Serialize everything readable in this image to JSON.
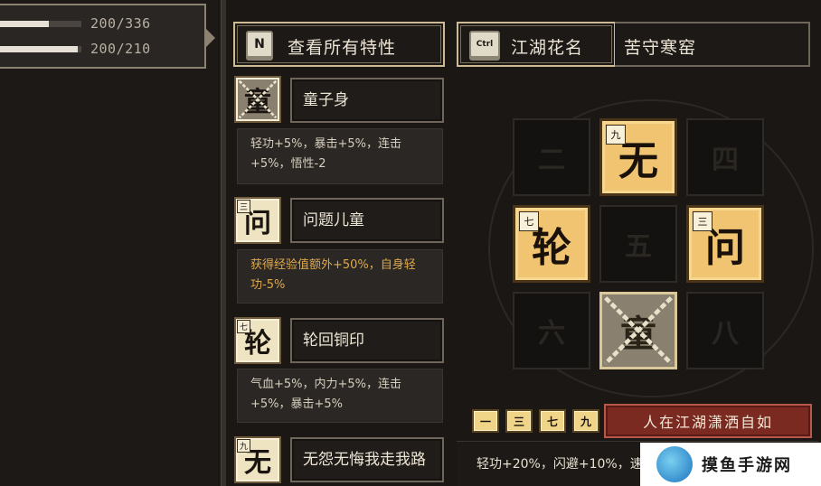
{
  "status": {
    "stats": [
      {
        "text": "200/336",
        "fill": 0.595
      },
      {
        "text": "200/210",
        "fill": 0.952
      }
    ]
  },
  "view_all_traits": {
    "key": "N",
    "label": "查看所有特性"
  },
  "traits": [
    {
      "glyph": "童",
      "num": "",
      "name": "童子身",
      "desc": "轻功+5%，暴击+5%，连击+5%，悟性-2",
      "highlight": false,
      "locked": true
    },
    {
      "glyph": "问",
      "num": "三",
      "name": "问题儿童",
      "desc": "获得经验值额外+50%，自身轻功-5%",
      "highlight": true,
      "locked": false
    },
    {
      "glyph": "轮",
      "num": "七",
      "name": "轮回铜印",
      "desc": "气血+5%，内力+5%，连击+5%，暴击+5%",
      "highlight": false,
      "locked": false
    },
    {
      "glyph": "无",
      "num": "九",
      "name": "无怨无悔我走我路",
      "desc": "",
      "highlight": false,
      "locked": false
    }
  ],
  "jianghu": {
    "key": "Ctrl",
    "label": "江湖花名",
    "value": "苦守寒窑"
  },
  "grid": [
    {
      "glyph": "二",
      "num": "",
      "state": "empty"
    },
    {
      "glyph": "无",
      "num": "九",
      "state": "lit"
    },
    {
      "glyph": "四",
      "num": "",
      "state": "empty"
    },
    {
      "glyph": "轮",
      "num": "七",
      "state": "lit"
    },
    {
      "glyph": "五",
      "num": "",
      "state": "empty"
    },
    {
      "glyph": "问",
      "num": "三",
      "state": "lit"
    },
    {
      "glyph": "六",
      "num": "",
      "state": "empty"
    },
    {
      "glyph": "童",
      "num": "",
      "state": "locked"
    },
    {
      "glyph": "八",
      "num": "",
      "state": "empty"
    }
  ],
  "combo": {
    "chips": [
      "一",
      "三",
      "七",
      "九"
    ],
    "title": "人在江湖潇洒自如",
    "desc": "轻功+20%，闪避+10%，速"
  },
  "watermark": {
    "text": "摸鱼手游网"
  },
  "colors": {
    "gold": "#f0c470",
    "banner": "#7a2a20",
    "frame": "#cdbb96"
  }
}
